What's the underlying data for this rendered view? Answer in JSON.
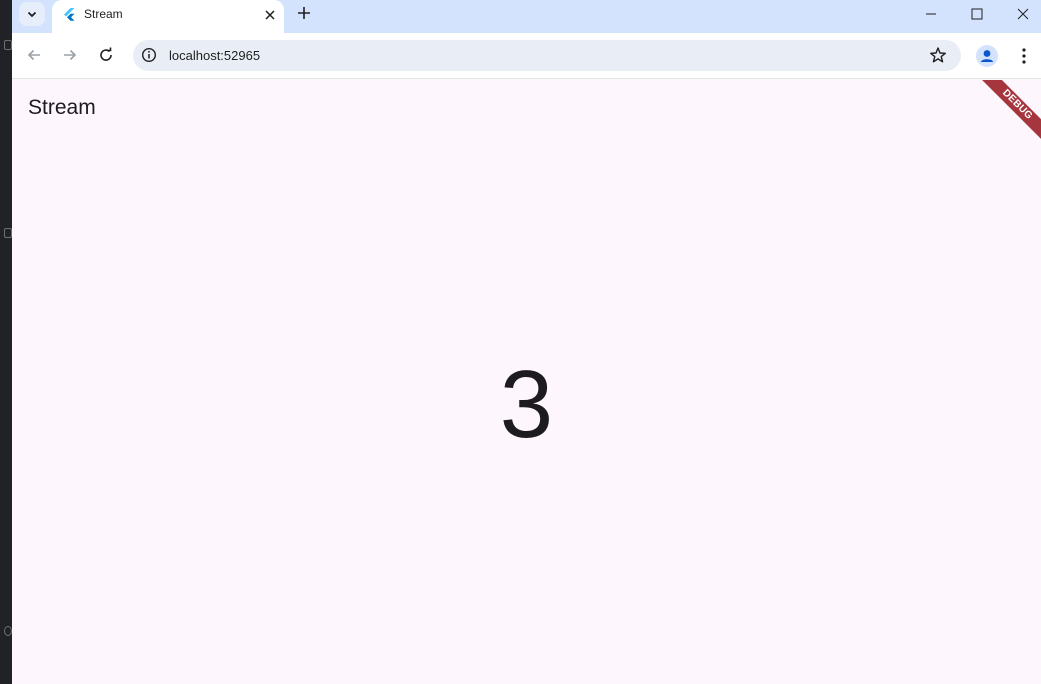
{
  "browser": {
    "tab": {
      "title": "Stream"
    },
    "address_bar": {
      "url": "localhost:52965"
    },
    "icons": {
      "tab_search": "chevron-down-icon",
      "favicon": "flutter-logo-icon",
      "tab_close": "close-icon",
      "new_tab": "plus-icon",
      "back": "arrow-left-icon",
      "forward": "arrow-right-icon",
      "reload": "reload-icon",
      "site_info": "info-icon",
      "bookmark": "star-icon",
      "profile": "profile-icon",
      "menu": "kebab-menu-icon"
    }
  },
  "app": {
    "appbar_title": "Stream",
    "counter_value": "3",
    "debug_banner": "DEBUG",
    "colors": {
      "background": "#fdf6fd",
      "text": "#1d1b20",
      "debug_banner": "#a5363e",
      "tabstrip": "#d3e3fd"
    }
  }
}
